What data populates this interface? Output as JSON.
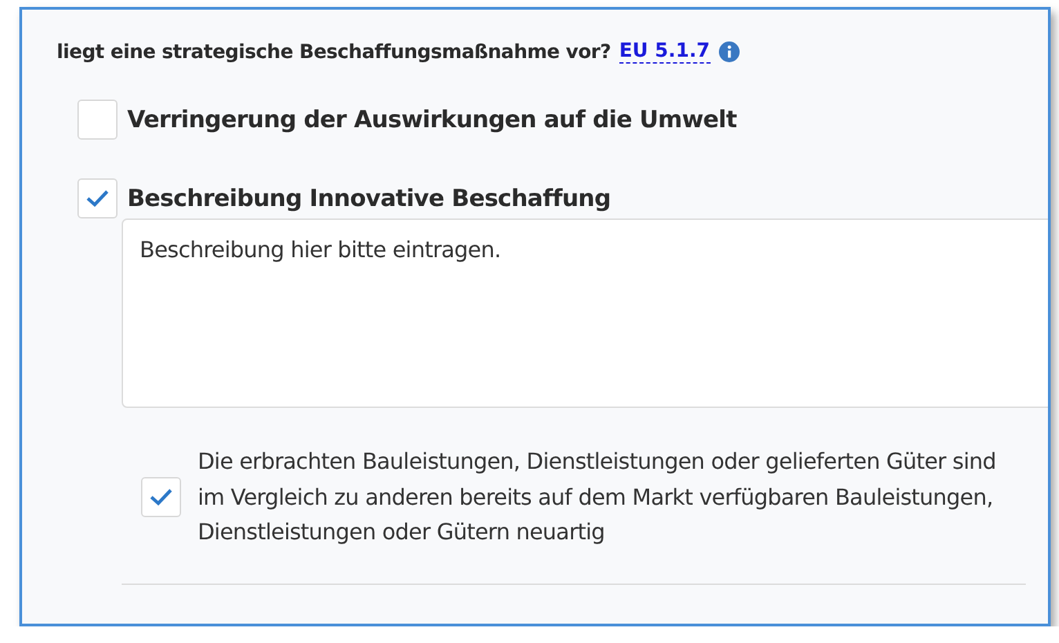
{
  "question": {
    "text": "liegt eine strategische Beschaffungsmaßnahme vor?",
    "link": "EU 5.1.7"
  },
  "options": [
    {
      "label": "Verringerung der Auswirkungen auf die Umwelt",
      "checked": false
    },
    {
      "label": "Beschreibung Innovative Beschaffung",
      "checked": true,
      "description": {
        "placeholder": "Beschreibung hier bitte eintragen."
      },
      "sub_options": [
        {
          "label": "Die erbrachten Bauleistungen, Dienstleistungen oder gelieferten Güter sind im Vergleich zu anderen bereits auf dem Markt verfügbaren Bauleistungen, Dienstleistungen oder Gütern neuartig",
          "checked": true
        }
      ]
    }
  ]
}
